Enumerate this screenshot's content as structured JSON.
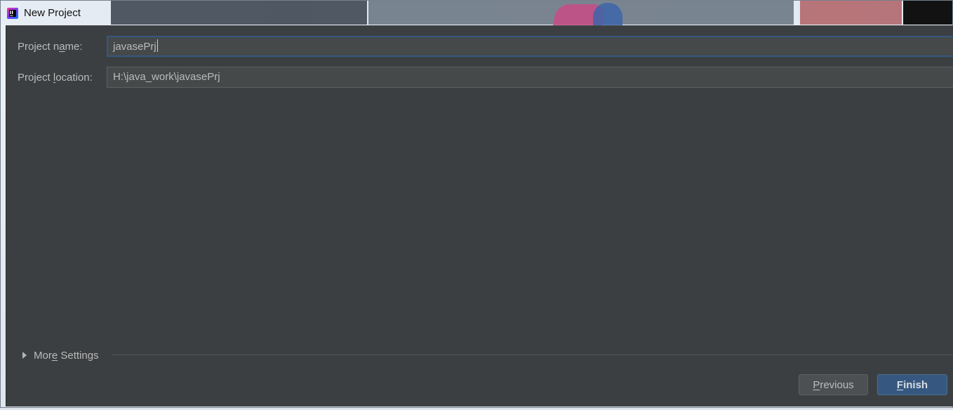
{
  "window": {
    "title": "New Project"
  },
  "form": {
    "project_name_label_before": "Project n",
    "project_name_label_mnemonic": "a",
    "project_name_label_after": "me:",
    "project_name_value": "javasePrj",
    "project_location_label_before": "Project ",
    "project_location_label_mnemonic": "l",
    "project_location_label_after": "ocation:",
    "project_location_value": "H:\\java_work\\javasePrj"
  },
  "more_settings": {
    "label_before": "Mor",
    "label_mnemonic": "e",
    "label_after": " Settings",
    "icon": "chevron-right-icon"
  },
  "buttons": {
    "previous_mnemonic": "P",
    "previous_rest": "revious",
    "finish_mnemonic": "F",
    "finish_rest": "inish"
  },
  "colors": {
    "dialog_background": "#3c3f41",
    "input_background": "#45494a",
    "focus_border": "#365880",
    "text": "#bbbbbb",
    "finish_button": "#365880",
    "previous_button": "#4c5052"
  },
  "icons": {
    "titlebar": "intellij-idea-icon"
  }
}
